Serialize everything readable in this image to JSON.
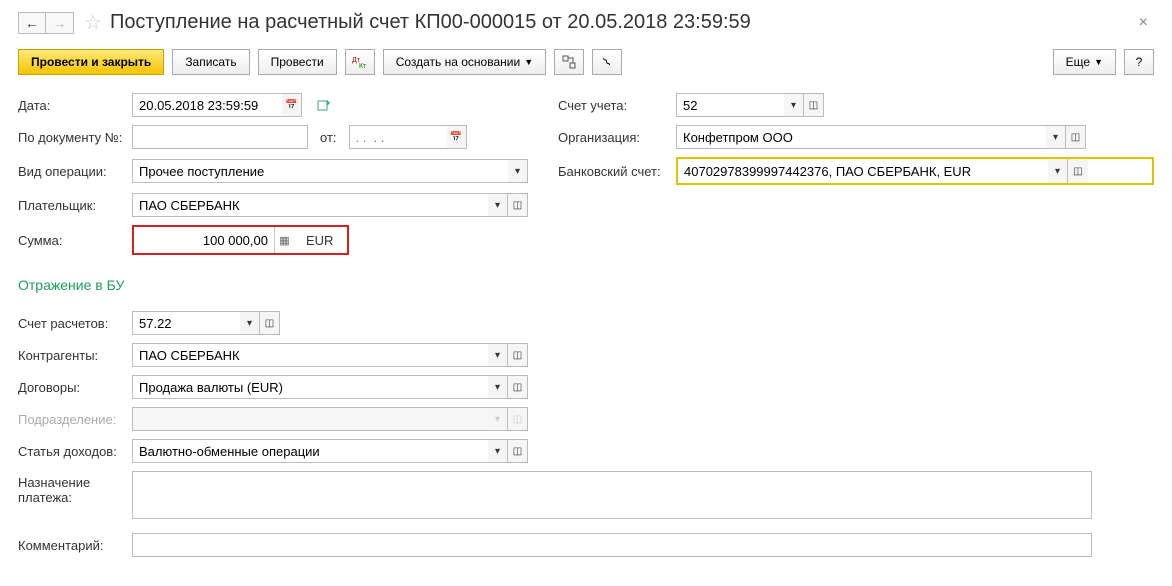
{
  "header": {
    "title": "Поступление на расчетный счет КП00-000015 от 20.05.2018 23:59:59"
  },
  "toolbar": {
    "post_close": "Провести и закрыть",
    "save": "Записать",
    "post": "Провести",
    "create_based": "Создать на основании",
    "more": "Еще",
    "help": "?"
  },
  "left": {
    "date_label": "Дата:",
    "date_value": "20.05.2018 23:59:59",
    "docnum_label": "По документу №:",
    "docnum_from": "от:",
    "docnum_date_placeholder": ". .  . .",
    "optype_label": "Вид операции:",
    "optype_value": "Прочее поступление",
    "payer_label": "Плательщик:",
    "payer_value": "ПАО СБЕРБАНК",
    "sum_label": "Сумма:",
    "sum_value": "100 000,00",
    "sum_currency": "EUR"
  },
  "right": {
    "account_label": "Счет учета:",
    "account_value": "52",
    "org_label": "Организация:",
    "org_value": "Конфетпром ООО",
    "bank_label": "Банковский счет:",
    "bank_value": "40702978399997442376, ПАО СБЕРБАНК, EUR"
  },
  "section": {
    "title": "Отражение в БУ",
    "settle_label": "Счет расчетов:",
    "settle_value": "57.22",
    "contragent_label": "Контрагенты:",
    "contragent_value": "ПАО СБЕРБАНК",
    "contract_label": "Договоры:",
    "contract_value": "Продажа валюты (EUR)",
    "division_label": "Подразделение:",
    "income_label": "Статья доходов:",
    "income_value": "Валютно-обменные операции",
    "purpose_label": "Назначение платежа:",
    "comment_label": "Комментарий:"
  }
}
